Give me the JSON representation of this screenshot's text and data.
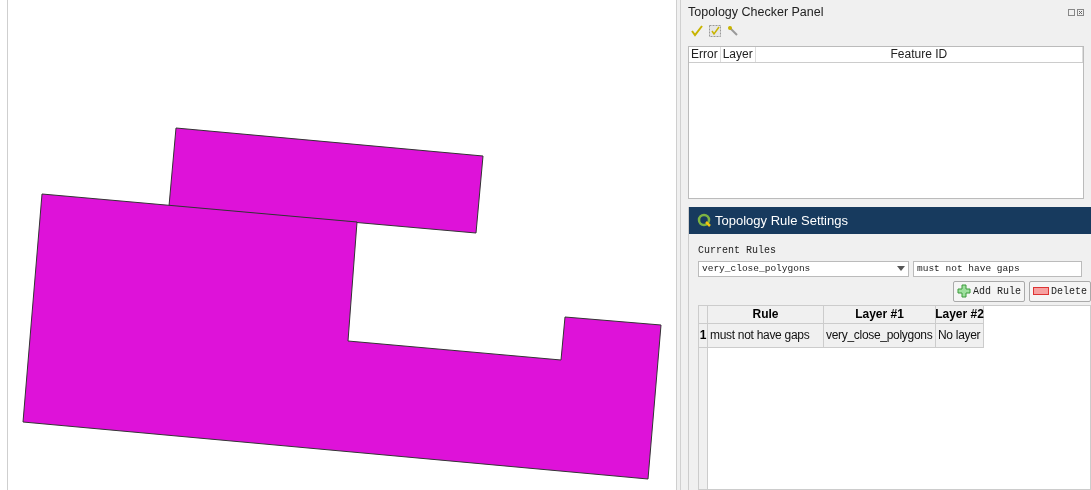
{
  "checker_panel": {
    "title": "Topology Checker Panel",
    "columns": [
      "Error",
      "Layer",
      "Feature ID"
    ]
  },
  "rule_settings": {
    "title": "Topology Rule Settings",
    "current_rules_label": "Current Rules",
    "layer_select": "very_close_polygons",
    "rule_select": "must not have gaps",
    "buttons": [
      {
        "kind": "add",
        "label": "Add Rule"
      },
      {
        "kind": "delete",
        "label": "Delete"
      }
    ],
    "table": {
      "columns": [
        "Rule",
        "Layer #1",
        "Layer #2"
      ],
      "rows": [
        {
          "index": "1",
          "cells": [
            "must not have gaps",
            "very_close_polygons",
            "No layer"
          ]
        }
      ]
    }
  }
}
